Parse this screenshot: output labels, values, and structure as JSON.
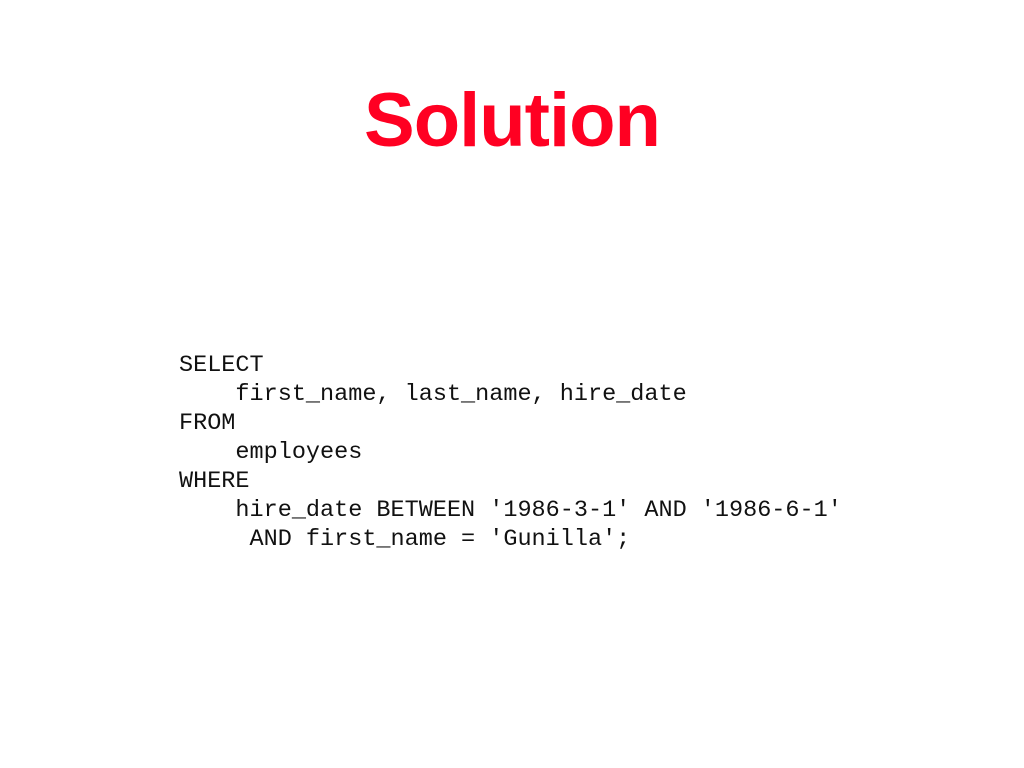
{
  "slide": {
    "title": "Solution",
    "title_color": "#ff0022",
    "code_lines": [
      "SELECT",
      "    first_name, last_name, hire_date",
      "FROM",
      "    employees",
      "WHERE",
      "    hire_date BETWEEN '1986-3-1' AND '1986-6-1'",
      "     AND first_name = 'Gunilla';"
    ]
  }
}
